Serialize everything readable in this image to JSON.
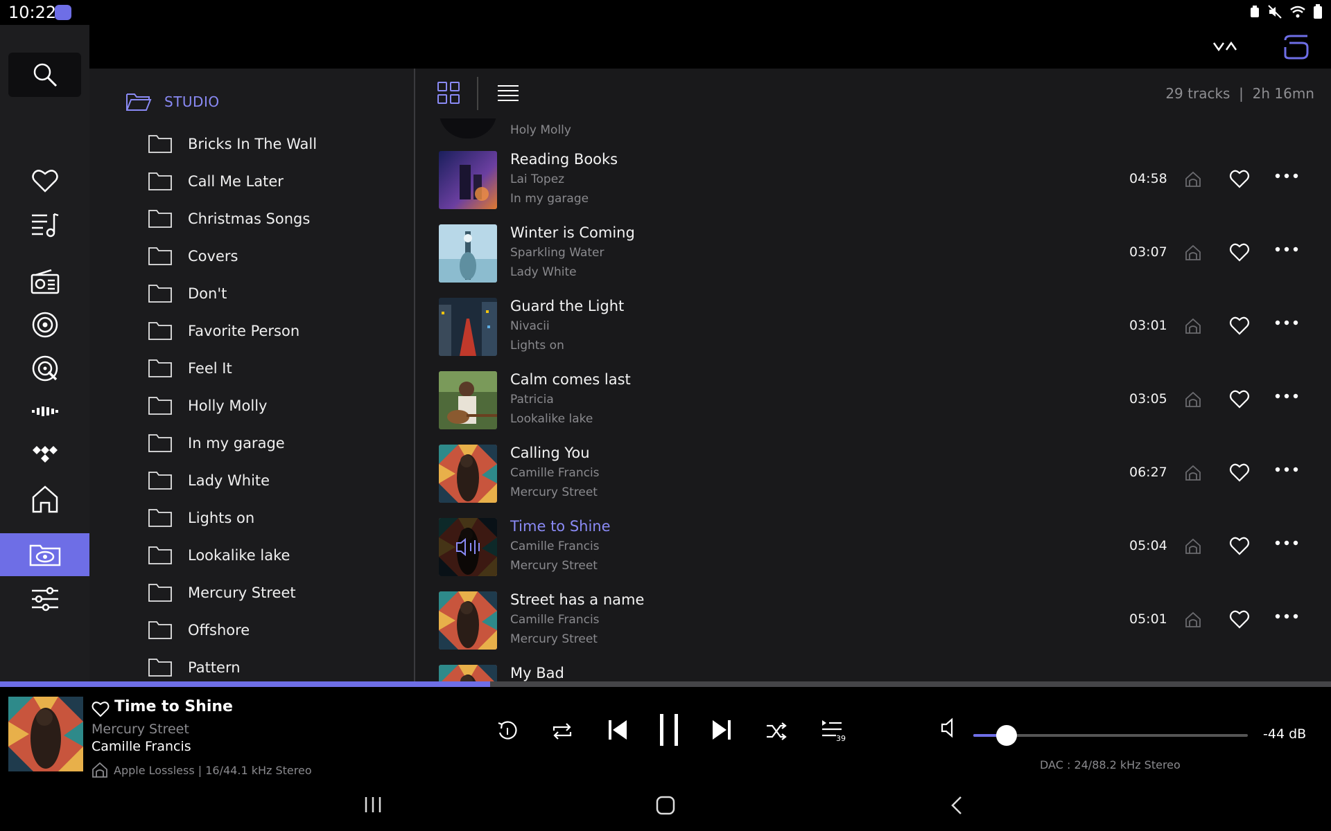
{
  "status": {
    "time": "10:22"
  },
  "folders": {
    "root_label": "STUDIO",
    "items": [
      "Bricks In The Wall",
      "Call Me Later",
      "Christmas Songs",
      "Covers",
      "Don't",
      "Favorite Person",
      "Feel It",
      "Holly Molly",
      "In my garage",
      "Lady White",
      "Lights on",
      "Lookalike lake",
      "Mercury Street",
      "Offshore",
      "Pattern"
    ]
  },
  "tracklist": {
    "summary": "29 tracks  |  2h 16mn",
    "partial_top_album": "Holy Molly",
    "tracks": [
      {
        "title": "Reading Books",
        "artist": "Lai Topez",
        "album": "In my garage",
        "duration": "04:58",
        "art": "night"
      },
      {
        "title": "Winter is Coming",
        "artist": "Sparkling Water",
        "album": "Lady White",
        "duration": "03:07",
        "art": "sky"
      },
      {
        "title": "Guard the Light",
        "artist": "Nivacii",
        "album": "Lights on",
        "duration": "03:01",
        "art": "city"
      },
      {
        "title": "Calm comes last",
        "artist": "Patricia",
        "album": "Lookalike lake",
        "duration": "03:05",
        "art": "guitar"
      },
      {
        "title": "Calling You",
        "artist": "Camille Francis",
        "album": "Mercury Street",
        "duration": "06:27",
        "art": "mosaic"
      },
      {
        "title": "Time to Shine",
        "artist": "Camille Francis",
        "album": "Mercury Street",
        "duration": "05:04",
        "art": "mosaic-playing",
        "playing": true
      },
      {
        "title": "Street has a name",
        "artist": "Camille Francis",
        "album": "Mercury Street",
        "duration": "05:01",
        "art": "mosaic"
      },
      {
        "title": "My Bad",
        "artist": "",
        "album": "",
        "duration": "",
        "art": "mosaic"
      }
    ]
  },
  "player": {
    "title": "Time to Shine",
    "album": "Mercury Street",
    "artist": "Camille Francis",
    "quality": "Apple Lossless | 16/44.1 kHz Stereo",
    "progress_fraction": 0.368,
    "queue_count": "39",
    "volume_fraction": 0.12,
    "volume_db": "-44 dB",
    "dac": "DAC : 24/88.2 kHz Stereo"
  },
  "colors": {
    "accent": "#6e6ee6",
    "accent_text": "#8a8af5",
    "panel": "#1b1b1d",
    "rail": "#1d1d1f"
  },
  "icons": {
    "rail": [
      "heart-icon",
      "playlist-icon",
      "radio-icon",
      "target-icon",
      "qobuz-icon",
      "deezer-icon",
      "tidal-icon",
      "home-icon",
      "folder-eye-icon",
      "equalizer-icon"
    ]
  }
}
